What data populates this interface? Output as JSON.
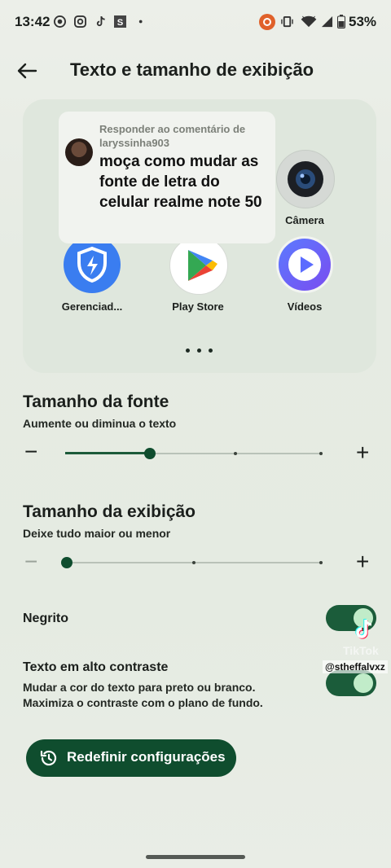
{
  "status_bar": {
    "time": "13:42",
    "battery_percent": "53%",
    "icons": [
      "chrome-media-icon",
      "instagram-icon",
      "tiktok-icon",
      "s-app-icon",
      "dot-icon",
      "cast-icon",
      "vibrate-icon",
      "wifi-icon",
      "signal-icon",
      "battery-icon"
    ]
  },
  "app_bar": {
    "back_icon": "arrow-left-icon",
    "title": "Texto e tamanho de exibição"
  },
  "preview": {
    "apps": [
      {
        "label": "Câmera",
        "icon": "camera-icon"
      },
      {
        "label": "Gerenciad...",
        "icon": "security-manager-icon"
      },
      {
        "label": "Play Store",
        "icon": "play-store-icon"
      },
      {
        "label": "Vídeos",
        "icon": "videos-play-icon"
      }
    ],
    "page_dots": 3
  },
  "comment": {
    "reply_label": "Responder ao comentário de laryssinha903",
    "text": "moça como mudar as fonte de letra do celular realme note 50"
  },
  "font_size": {
    "title": "Tamanho da fonte",
    "subtitle": "Aumente ou diminua o texto",
    "level_fraction": 0.33,
    "steps": 4
  },
  "display_size": {
    "title": "Tamanho da exibição",
    "subtitle": "Deixe tudo maior ou menor",
    "level_fraction": 0,
    "steps": 3
  },
  "bold": {
    "label": "Negrito",
    "enabled": true
  },
  "high_contrast": {
    "label": "Texto em alto contraste",
    "description": "Mudar a cor do texto para preto ou branco. Maximiza o contraste com o plano de fundo.",
    "enabled": true
  },
  "reset_button": {
    "label": "Redefinir configurações",
    "icon": "history-icon"
  },
  "watermark": {
    "brand": "TikTok",
    "username": "@stheffalvxz"
  },
  "colors": {
    "accent": "#0f4d2e",
    "switch_on": "#1b5c3a",
    "background": "#e6ebe3"
  }
}
